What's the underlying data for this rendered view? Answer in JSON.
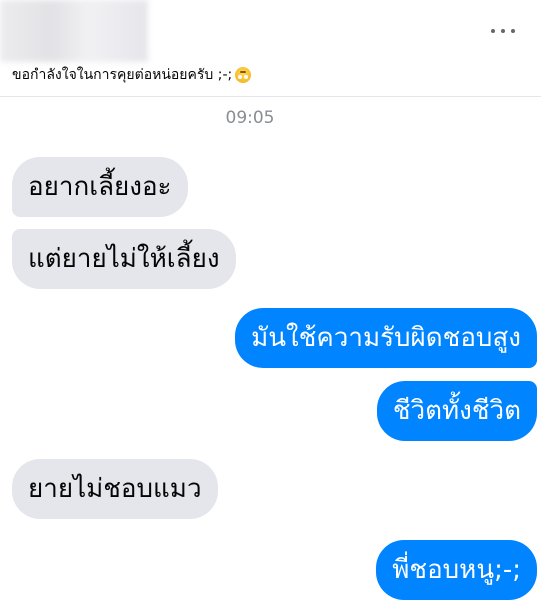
{
  "post": {
    "caption": "ขอกำลังใจในการคุยต่อหน่อยครับ ;-;",
    "caption_emoji": "pleading-face-emoji",
    "more_icon": "more-horizontal-icon"
  },
  "chat": {
    "timestamp": "09:05",
    "messages": [
      {
        "sender": "other",
        "text": "อยากเลี้ยงอะ"
      },
      {
        "sender": "other",
        "text": "แต่ยายไม่ให้เลี้ยง"
      },
      {
        "sender": "me",
        "text": "มันใช้ความรับผิดชอบสูง"
      },
      {
        "sender": "me",
        "text": "ชีวิตทั้งชีวิต"
      },
      {
        "sender": "other",
        "text": "ยายไม่ชอบแมว"
      },
      {
        "sender": "me",
        "text": "พี่ชอบหนู;-;"
      }
    ],
    "colors": {
      "sent_bubble": "#0084ff",
      "received_bubble": "#e4e6eb",
      "timestamp_text": "#8a8d91"
    }
  }
}
